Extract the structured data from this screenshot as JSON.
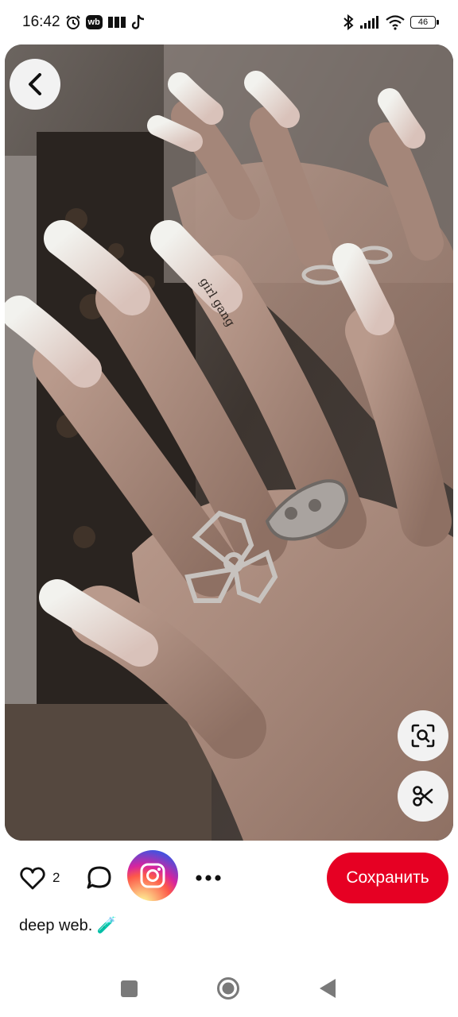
{
  "status_bar": {
    "time": "16:42",
    "icons": [
      "alarm-icon",
      "wb-icon",
      "sim-icon",
      "tiktok-icon",
      "bluetooth-icon",
      "signal-icon",
      "wifi-icon"
    ],
    "wb_label": "wb",
    "battery": "46"
  },
  "photo": {
    "nail_text": "girl gang",
    "icon": "back-arrow-icon"
  },
  "float_buttons": {
    "lens_icon": "visual-search-icon",
    "cut_icon": "scissors-icon"
  },
  "actions": {
    "like_count": "2",
    "save_label": "Сохранить",
    "colors": {
      "save": "#e60023"
    }
  },
  "pin": {
    "title": "deep web. 🧪"
  },
  "nav": {
    "icons": [
      "recent-apps-icon",
      "home-icon",
      "back-icon"
    ]
  }
}
